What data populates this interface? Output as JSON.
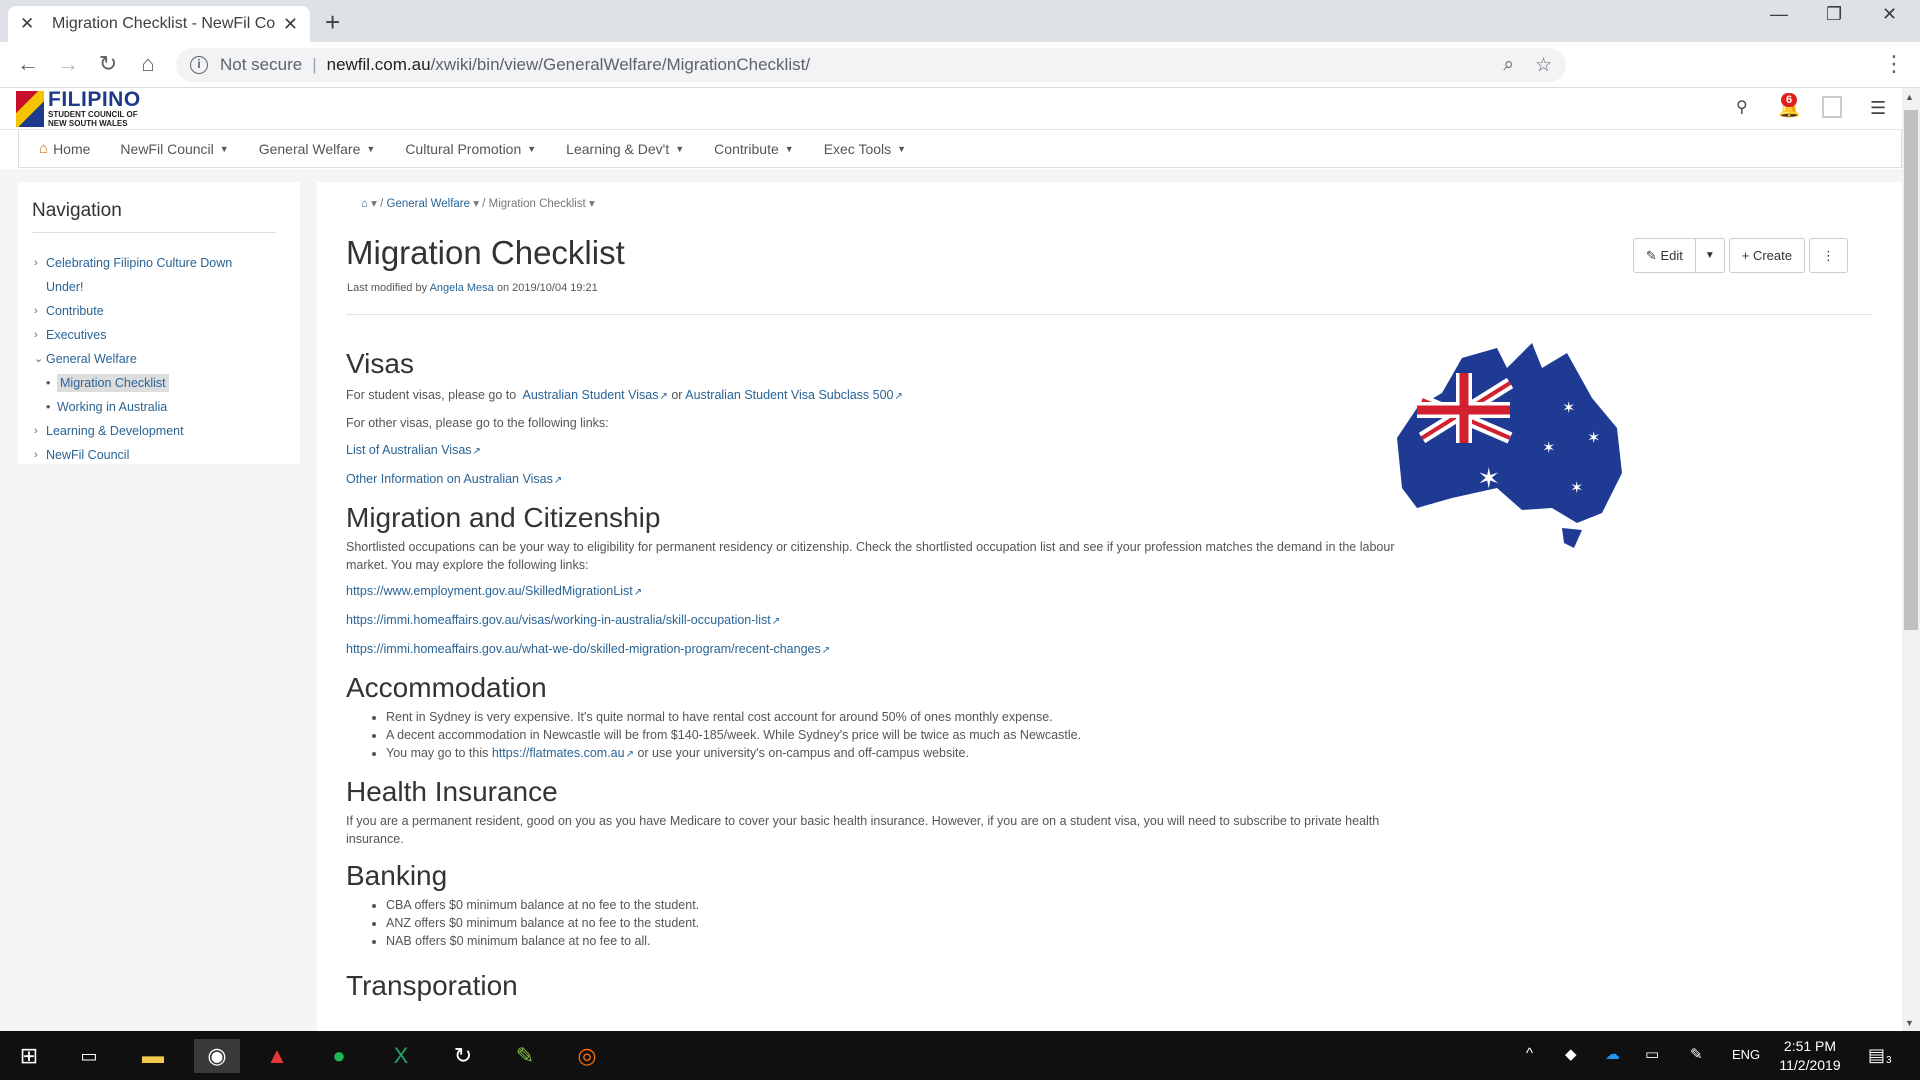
{
  "browser": {
    "tab_title": "Migration Checklist - NewFil Cou",
    "security_label": "Not secure",
    "url_host": "newfil.com.au",
    "url_path": "/xwiki/bin/view/GeneralWelfare/MigrationChecklist/"
  },
  "site": {
    "logo_big": "FILIPINO",
    "logo_small_1": "STUDENT COUNCIL OF",
    "logo_small_2": "NEW SOUTH WALES",
    "notification_count": "6"
  },
  "menu": {
    "items": [
      {
        "label": "Home"
      },
      {
        "label": "NewFil Council"
      },
      {
        "label": "General Welfare"
      },
      {
        "label": "Cultural Promotion"
      },
      {
        "label": "Learning & Dev't"
      },
      {
        "label": "Contribute"
      },
      {
        "label": "Exec Tools"
      }
    ]
  },
  "sidebar": {
    "title": "Navigation",
    "items": [
      {
        "label": "Celebrating Filipino Culture Down"
      },
      {
        "label": "Under!"
      },
      {
        "label": "Contribute"
      },
      {
        "label": "Executives"
      },
      {
        "label": "General Welfare"
      },
      {
        "label": "Migration Checklist"
      },
      {
        "label": "Working in Australia"
      },
      {
        "label": "Learning & Development"
      },
      {
        "label": "NewFil Council"
      }
    ]
  },
  "breadcrumb": {
    "level1": "General Welfare",
    "level2": "Migration Checklist"
  },
  "page": {
    "title": "Migration Checklist",
    "modified_prefix": "Last modified by",
    "modified_author": "Angela Mesa",
    "modified_suffix": "on 2019/10/04 19:21",
    "edit_label": "Edit",
    "create_label": "Create"
  },
  "sections": {
    "visas": {
      "heading": "Visas",
      "intro": "For student visas, please go to",
      "link1": "Australian Student Visas",
      "or": "or",
      "link2": "Australian Student Visa Subclass 500",
      "other": "For other visas, please go to the following links:",
      "link3": "List of Australian Visas",
      "link4": "Other Information on Australian Visas"
    },
    "migration": {
      "heading": "Migration and Citizenship",
      "text": "Shortlisted occupations can be your way to eligibility for permanent residency or citizenship. Check the shortlisted occupation list and see if your profession matches the demand in the labour market. You may explore the following links:",
      "link1": "https://www.employment.gov.au/SkilledMigrationList",
      "link2": "https://immi.homeaffairs.gov.au/visas/working-in-australia/skill-occupation-list",
      "link3": "https://immi.homeaffairs.gov.au/what-we-do/skilled-migration-program/recent-changes"
    },
    "accommodation": {
      "heading": "Accommodation",
      "item1": "Rent in Sydney is very expensive. It's quite normal to have rental cost account for around 50% of ones monthly expense.",
      "item2": "A decent accommodation in Newcastle will be from $140-185/week. While Sydney's price will be twice as much as Newcastle.",
      "item3_prefix": "You may go to this",
      "item3_link": "https://flatmates.com.au",
      "item3_suffix": "or use your university's on-campus and off-campus website."
    },
    "health": {
      "heading": "Health Insurance",
      "text": "If you are a permanent resident, good on you as you have Medicare to cover your basic health insurance. However, if you are on a student visa, you will need to subscribe to private health insurance."
    },
    "banking": {
      "heading": "Banking",
      "item1": "CBA offers $0 minimum balance at no fee to the student.",
      "item2": "ANZ offers $0 minimum balance at no fee to the student.",
      "item3": "NAB offers $0 minimum balance at no fee to all."
    },
    "transport": {
      "heading": "Transporation"
    }
  },
  "taskbar": {
    "language": "ENG",
    "time": "2:51 PM",
    "date": "11/2/2019",
    "notifications": "3"
  }
}
